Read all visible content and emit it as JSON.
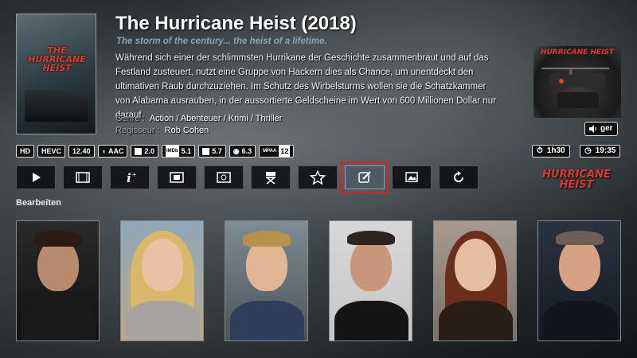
{
  "movie": {
    "title": "The Hurricane Heist (2018)",
    "tagline": "The storm of the century... the heist of a lifetime.",
    "plot": "Während sich einer der schlimmsten Hurrikane der Geschichte zusammenbraut und auf das Festland zusteuert, nutzt eine Gruppe von Hackern dies als Chance, um unentdeckt den ultimativen Raub durchzuziehen. Im Schutz des Wirbelsturms wollen sie die Schatzkammer von Alabama ausrauben, in der aussortierte Geldscheine im Wert von 600 Millionen Dollar nur darauf",
    "genre_label": "Genre :",
    "genre_value": "Action / Abenteuer / Krimi / Thriller",
    "director_label": "Regisseur :",
    "director_value": "Rob Cohen",
    "poster_title": "THE HURRICANE HEIST",
    "logo_text": "HURRICANE HEIST"
  },
  "audio_lang": "ger",
  "badges": {
    "hd": "HD",
    "hevc": "HEVC",
    "resolution": "12.40",
    "audio_codec": "AAC",
    "channels": "2.0",
    "imdb_label": "IMDb",
    "imdb": "5.1",
    "tmdb": "5.7",
    "rt": "6.3",
    "mpaa_label": "MPAA",
    "mpaa": "12"
  },
  "runtime": "1h30",
  "end_time": "19:35",
  "toolbar": {
    "buttons": [
      "play",
      "trailer",
      "info",
      "film",
      "movie-set",
      "director",
      "favorite",
      "edit",
      "images",
      "refresh"
    ],
    "active_index": 7,
    "active_label": "Bearbeiten"
  },
  "cast_count": 6,
  "colors": {
    "accent_red": "#e02020",
    "tagline_blue": "#8aa4b5"
  }
}
